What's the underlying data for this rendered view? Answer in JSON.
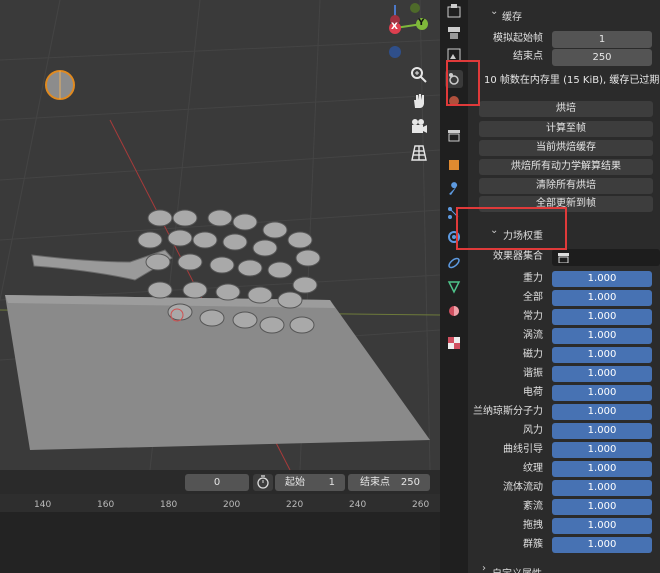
{
  "viewport": {
    "axes": {
      "x": "X",
      "y": "Y"
    },
    "nav_icons": [
      "zoom-icon",
      "hand-pan-icon",
      "camera-view-icon",
      "grid-perspective-icon"
    ]
  },
  "timeline": {
    "current_frame": "0",
    "start_label": "起始",
    "start_value": "1",
    "end_label": "结束点",
    "end_value": "250",
    "ticks": [
      "140",
      "160",
      "180",
      "200",
      "220",
      "240",
      "260"
    ]
  },
  "properties": {
    "cache": {
      "header": "缓存",
      "sim_start_label": "模拟起始帧",
      "sim_start_value": "1",
      "end_label": "结束点",
      "end_value": "250",
      "status": "10 帧数在内存里 (15 KiB), 缓存已过期!"
    },
    "buttons": [
      "烘培",
      "计算至帧",
      "当前烘焙缓存",
      "烘焙所有动力学解算结果",
      "清除所有烘培",
      "全部更新到帧"
    ],
    "field_weights": {
      "header": "力场权重",
      "effector_label": "效果器集合",
      "items": [
        {
          "label": "重力",
          "value": "1.000"
        },
        {
          "label": "全部",
          "value": "1.000"
        },
        {
          "label": "常力",
          "value": "1.000"
        },
        {
          "label": "涡流",
          "value": "1.000"
        },
        {
          "label": "磁力",
          "value": "1.000"
        },
        {
          "label": "谐振",
          "value": "1.000"
        },
        {
          "label": "电荷",
          "value": "1.000"
        },
        {
          "label": "兰纳琼斯分子力",
          "value": "1.000"
        },
        {
          "label": "风力",
          "value": "1.000"
        },
        {
          "label": "曲线引导",
          "value": "1.000"
        },
        {
          "label": "纹理",
          "value": "1.000"
        },
        {
          "label": "流体流动",
          "value": "1.000"
        },
        {
          "label": "紊流",
          "value": "1.000"
        },
        {
          "label": "拖拽",
          "value": "1.000"
        },
        {
          "label": "群簇",
          "value": "1.000"
        }
      ]
    },
    "custom_props": "自定义属性"
  },
  "colors": {
    "accent_blue": "#4772b3",
    "highlight_red": "#e03a3a"
  }
}
